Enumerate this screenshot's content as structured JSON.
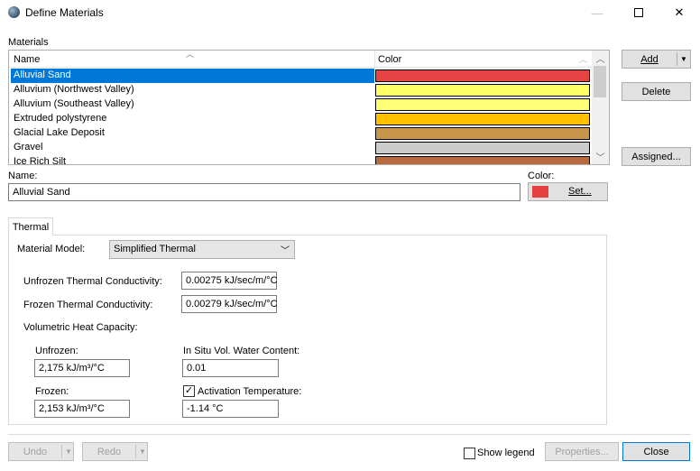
{
  "window": {
    "title": "Define Materials",
    "icon": "globe-icon",
    "minimize_glyph": "—",
    "close_glyph": "✕"
  },
  "materials": {
    "section_label": "Materials",
    "columns": {
      "name": "Name",
      "color": "Color"
    },
    "rows": [
      {
        "name": "Alluvial Sand",
        "color": "#e64444",
        "selected": true
      },
      {
        "name": "Alluvium (Northwest Valley)",
        "color": "#ffff66",
        "selected": false
      },
      {
        "name": "Alluvium (Southeast Valley)",
        "color": "#ffff77",
        "selected": false
      },
      {
        "name": "Extruded polystyrene",
        "color": "#ffc000",
        "selected": false
      },
      {
        "name": "Glacial Lake Deposit",
        "color": "#c8964a",
        "selected": false
      },
      {
        "name": "Gravel",
        "color": "#cccccc",
        "selected": false
      },
      {
        "name": "Ice Rich Silt",
        "color": "#b86a40",
        "selected": false
      }
    ]
  },
  "buttons": {
    "add": "Add",
    "delete": "Delete",
    "assigned": "Assigned...",
    "set": "Set...",
    "undo": "Undo",
    "redo": "Redo",
    "properties": "Properties...",
    "close": "Close"
  },
  "name_field": {
    "label": "Name:",
    "value": "Alluvial Sand"
  },
  "color_field": {
    "label": "Color:",
    "value": "#e74040"
  },
  "tabs": [
    {
      "label": "Thermal",
      "active": true
    }
  ],
  "thermal": {
    "material_model_label": "Material Model:",
    "material_model_value": "Simplified Thermal",
    "unfrozen_conductivity_label": "Unfrozen Thermal Conductivity:",
    "unfrozen_conductivity_value": "0.00275 kJ/sec/m/°C",
    "frozen_conductivity_label": "Frozen Thermal Conductivity:",
    "frozen_conductivity_value": "0.00279 kJ/sec/m/°C",
    "heat_capacity_label": "Volumetric Heat Capacity:",
    "unfrozen_label": "Unfrozen:",
    "unfrozen_value": "2,175 kJ/m³/°C",
    "frozen_label": "Frozen:",
    "frozen_value": "2,153 kJ/m³/°C",
    "water_content_label": "In Situ Vol. Water Content:",
    "water_content_value": "0.01",
    "activation_label": "Activation Temperature:",
    "activation_checked": true,
    "activation_value": "-1.14 °C"
  },
  "show_legend": {
    "label": "Show legend",
    "checked": false
  }
}
